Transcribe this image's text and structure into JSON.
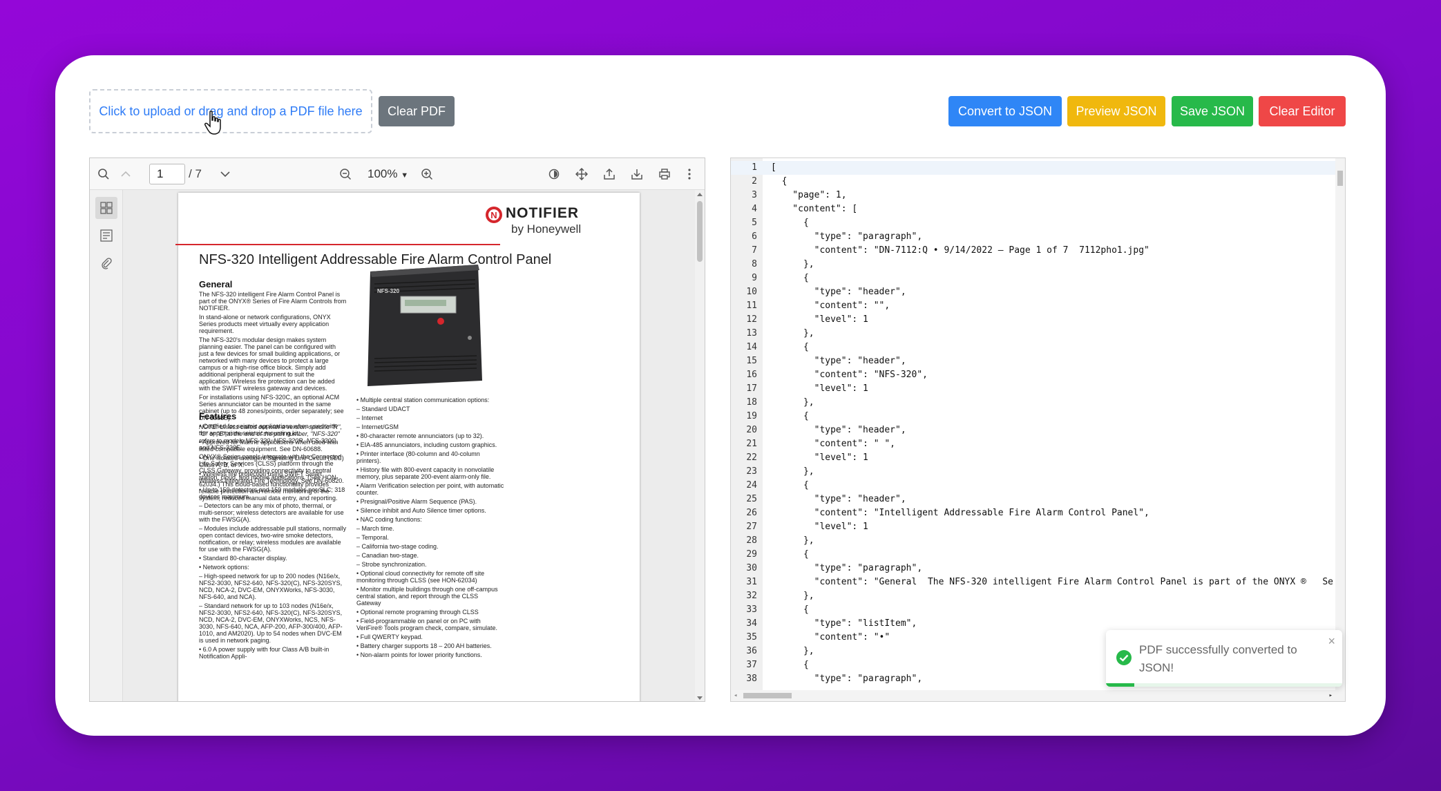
{
  "upload": {
    "dropzone_text": "Click to upload or drag and drop a PDF file here",
    "clear_pdf_label": "Clear PDF"
  },
  "actions": {
    "convert_label": "Convert to JSON",
    "preview_label": "Preview JSON",
    "save_label": "Save JSON",
    "clear_editor_label": "Clear Editor",
    "colors": {
      "convert": "#2f86f6",
      "preview": "#f0b80e",
      "save": "#27b94a",
      "clear_editor": "#ef4747",
      "clear_pdf": "#6c757d"
    }
  },
  "viewer": {
    "page_current": "1",
    "page_total": "/ 7",
    "zoom": "100%",
    "toolbar_icons": [
      "search-icon",
      "chevron-up-icon",
      "chevron-down-icon",
      "zoom-out-icon",
      "zoom-in-icon",
      "rotate-icon",
      "pan-icon",
      "share-icon",
      "download-icon",
      "print-icon",
      "more-icon"
    ],
    "sidebar_icons": [
      "thumbnails-icon",
      "outline-icon",
      "attachment-icon"
    ],
    "document": {
      "brand": "NOTIFIER",
      "brand_sub": "by Honeywell",
      "title": "NFS-320 Intelligent Addressable Fire Alarm Control Panel",
      "section_general": "General",
      "section_features": "Features",
      "panel_label": "NFS-320",
      "general_paragraphs": [
        "The NFS-320 intelligent Fire Alarm Control Panel is part of the ONYX® Series of Fire Alarm Controls from NOTIFIER.",
        "In stand-alone or network configurations, ONYX Series products meet virtually every application requirement.",
        "The NFS-320's modular design makes system planning easier. The panel can be configured with just a few devices for small building applications, or networked with many devices to protect a large campus or a high-rise office block. Simply add additional peripheral equipment to suit the application. Wireless fire protection can be added with the SWIFT wireless gateway and devices.",
        "For installations using NFS-320C, an optional ACM Series annunciator can be mounted in the same cabinet (up to 48 zones/points, order separately; see DN-6008S).",
        "NOTE: Unless called out with a version-specific \"R\", \"C\" or \"E\" at the end of the part number, \"NFS-320\" refers to models NFS-320, NFS-320R, NFS-320C, and NFS-320E.",
        "ONYX® Series panels integrate with the Connected Life Safety Services (CLSS) platform through the CLSS Gateway, providing connectivity to central station, cloud, and mobile applications. (See HON-62034.) This cloud-based functionality provides reliable protection and remote monitoring of the system, reduced manual data entry, and reporting."
      ],
      "features_left": [
        "• Certified for seismic applications when used with the appropriate seismic mounting kit.",
        "• Approved for Marine applications when used with listed compatible equipment. See DN-60688.",
        "• One isolated intelligent Signaling Line Circuit (SLC) Class A, B, or X.",
        "• Wireless fire protection using SWIFT Smart Wireless Integrated Fire Technology. See DN-60820.",
        "• Up to 159 detectors and 159 modules per SLC; 318 devices maximum.",
        "  – Detectors can be any mix of photo, thermal, or multi-sensor; wireless detectors are available for use with the FWSG(A).",
        "  – Modules include addressable pull stations, normally open contact devices, two-wire smoke detectors, notification, or relay; wireless modules are available for use with the FWSG(A).",
        "• Standard 80-character display.",
        "• Network options:",
        "  – High-speed network for up to 200 nodes (N16e/x, NFS2-3030, NFS2-640, NFS-320(C), NFS-320SYS, NCD, NCA-2, DVC-EM, ONYXWorks, NFS-3030, NFS-640, and NCA).",
        "  – Standard network for up to 103 nodes (N16e/x, NFS2-3030, NFS2-640, NFS-320(C), NFS-320SYS, NCD, NCA-2, DVC-EM, ONYXWorks, NCS, NFS-3030, NFS-640, NCA, AFP-200, AFP-300/400, AFP-1010, and AM2020). Up to 54 nodes when DVC-EM is used in network paging.",
        "• 6.0 A power supply with four Class A/B built-in Notification Appli-"
      ],
      "features_right": [
        "• Multiple central station communication options:",
        "  – Standard UDACT",
        "  – Internet",
        "  – Internet/GSM",
        "• 80-character remote annunciators (up to 32).",
        "• EIA-485 annunciators, including custom graphics.",
        "• Printer interface (80-column and 40-column printers).",
        "• History file with 800-event capacity in nonvolatile memory, plus separate 200-event alarm-only file.",
        "• Alarm Verification selection per point, with automatic counter.",
        "• Presignal/Positive Alarm Sequence (PAS).",
        "• Silence inhibit and Auto Silence timer options.",
        "• NAC coding functions:",
        "  – March time.",
        "  – Temporal.",
        "  – California two-stage coding.",
        "  – Canadian two-stage.",
        "  – Strobe synchronization.",
        "• Optional cloud connectivity for remote off site monitoring through CLSS (see HON-62034)",
        "• Monitor multiple buildings through one off-campus central station, and report through the CLSS Gateway",
        "• Optional remote programing through CLSS",
        "• Field-programmable on panel or on PC with VeriFire® Tools program check, compare, simulate.",
        "• Full QWERTY keypad.",
        "• Battery charger supports 18 – 200 AH batteries.",
        "• Non-alarm points for lower priority functions."
      ]
    }
  },
  "editor": {
    "lines": [
      "[",
      "  {",
      "    \"page\": 1,",
      "    \"content\": [",
      "      {",
      "        \"type\": \"paragraph\",",
      "        \"content\": \"DN-7112:Q • 9/14/2022 — Page 1 of 7  7112pho1.jpg\"",
      "      },",
      "      {",
      "        \"type\": \"header\",",
      "        \"content\": \"\",",
      "        \"level\": 1",
      "      },",
      "      {",
      "        \"type\": \"header\",",
      "        \"content\": \"NFS-320\",",
      "        \"level\": 1",
      "      },",
      "      {",
      "        \"type\": \"header\",",
      "        \"content\": \" \",",
      "        \"level\": 1",
      "      },",
      "      {",
      "        \"type\": \"header\",",
      "        \"content\": \"Intelligent Addressable Fire Alarm Control Panel\",",
      "        \"level\": 1",
      "      },",
      "      {",
      "        \"type\": \"paragraph\",",
      "        \"content\": \"General  The NFS-320 intelligent Fire Alarm Control Panel is part of the ONYX ®   Se",
      "      },",
      "      {",
      "        \"type\": \"listItem\",",
      "        \"content\": \"•\"",
      "      },",
      "      {",
      "        \"type\": \"paragraph\","
    ]
  },
  "toast": {
    "message": "PDF successfully converted to JSON!",
    "close_label": "×",
    "progress": 0.12
  }
}
